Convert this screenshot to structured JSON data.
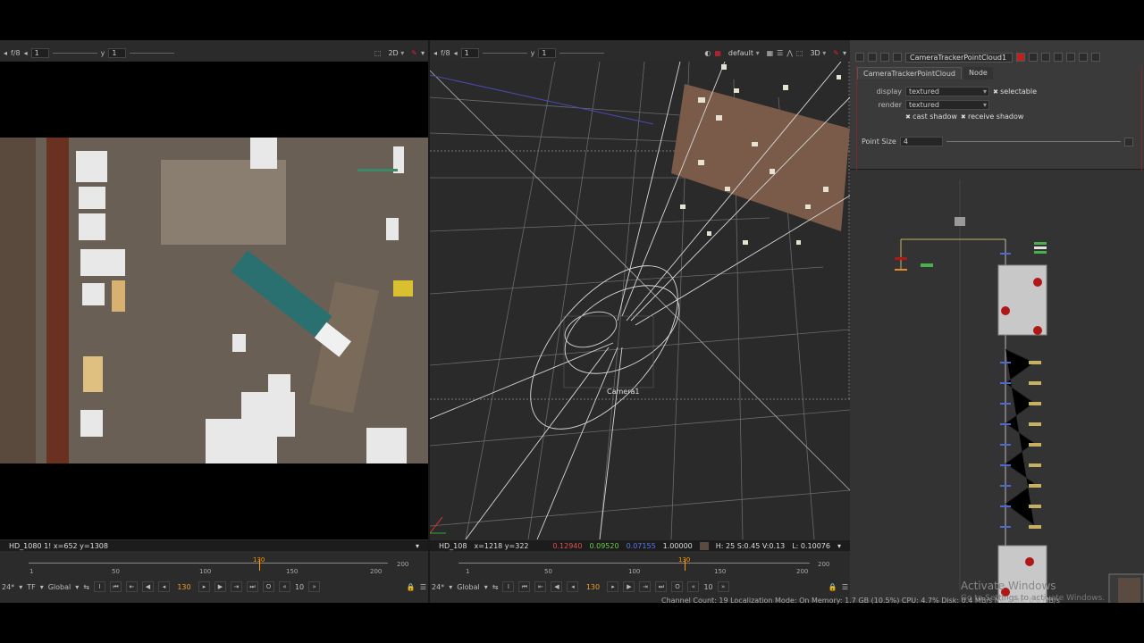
{
  "left_viewer": {
    "toolbar": {
      "fstop": "f/8",
      "frame_field": "1",
      "y_label": "y",
      "y_field": "1",
      "mode": "2D"
    },
    "status": "HD_1080 1!  x=652 y=1308",
    "timeline": {
      "ticks": [
        "1",
        "50",
        "100",
        "150",
        "200"
      ],
      "end_value": "200",
      "current_label": "130"
    },
    "playbar": {
      "fps": "24*",
      "tf": "TF",
      "scope": "Global",
      "current_frame": "130",
      "step": "10"
    }
  },
  "right_viewer": {
    "toolbar": {
      "fstop": "f/8",
      "frame_field": "1",
      "y_label": "y",
      "y_field": "1",
      "lut": "default",
      "mode": "3D"
    },
    "status": {
      "format": "HD_108",
      "coords": "x=1218 y=322",
      "r": "0.12940",
      "g": "0.09520",
      "b": "0.07155",
      "a": "1.00000",
      "hsv": "H: 25 S:0.45 V:0.13",
      "lum": "L: 0.10076"
    },
    "camera_label": "Camera1",
    "timeline": {
      "ticks": [
        "1",
        "50",
        "100",
        "150",
        "200"
      ],
      "end_value": "200",
      "current_label": "130"
    },
    "playbar": {
      "fps": "24*",
      "scope": "Global",
      "current_frame": "130",
      "step": "10"
    }
  },
  "properties": {
    "node_name": "CameraTrackerPointCloud1",
    "tabs": [
      "CameraTrackerPointCloud",
      "Node"
    ],
    "display_label": "display",
    "display_value": "textured",
    "selectable_label": "selectable",
    "render_label": "render",
    "render_value": "textured",
    "cast_shadow_label": "cast shadow",
    "receive_shadow_label": "receive shadow",
    "point_size_label": "Point Size",
    "point_size_value": "4"
  },
  "watermark": {
    "line1": "Activate Windows",
    "line2": "Go to Settings to activate Windows."
  },
  "bottom_status": "Channel Count: 19  Localization Mode: On  Memory: 1.7 GB (10.5%)  CPU: 4.7%  Disk: 0.4 MB/s  Network: 0.0 MB/s",
  "colors": {
    "accent_orange": "#f39a2a",
    "node_red": "#b01818",
    "pipe_blue": "#4a6ad0",
    "pipe_yellow": "#c9b060"
  }
}
